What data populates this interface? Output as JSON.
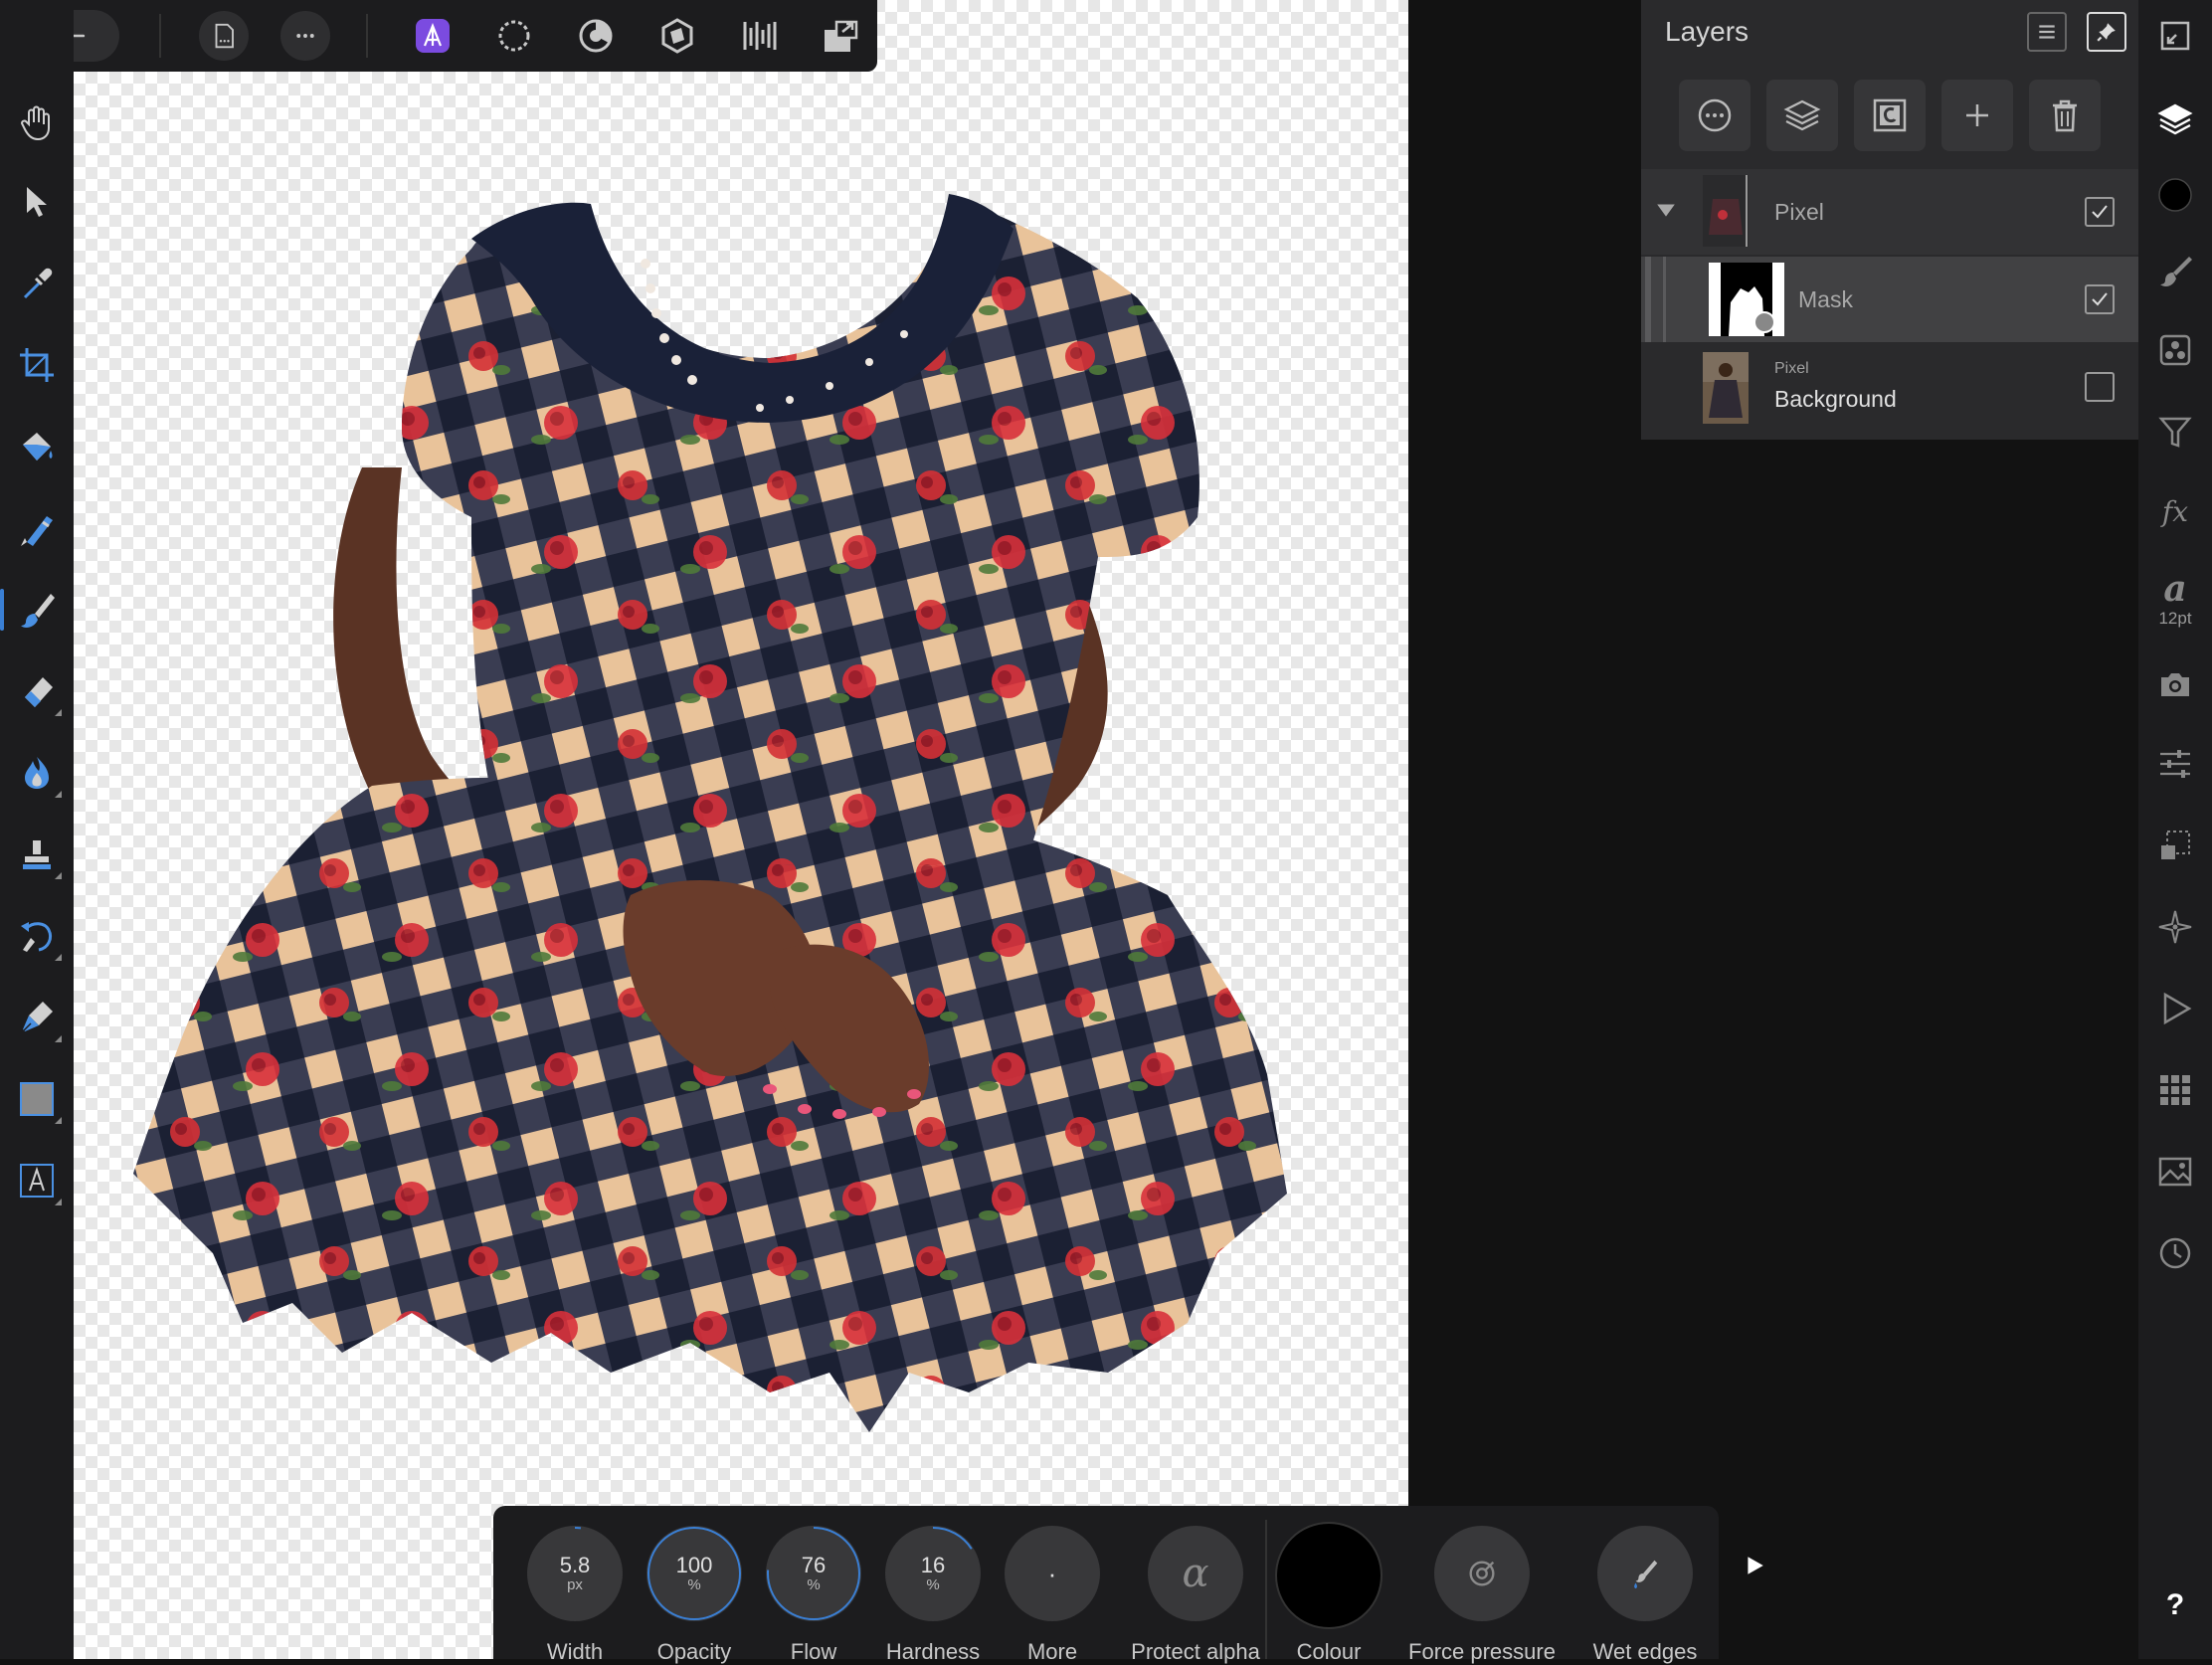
{
  "app": {
    "accent": "#7b4be0",
    "selection_blue": "#3a7fd4"
  },
  "top_toolbar": {
    "icons": [
      "back-arrow-icon",
      "document-icon",
      "more-icon",
      "photo-persona-icon",
      "liquify-persona-icon",
      "develop-persona-icon",
      "tone-mapping-persona-icon",
      "export-persona-icon",
      "arrange-icon"
    ]
  },
  "layers_panel": {
    "title": "Layers",
    "layers": [
      {
        "type": "",
        "name": "Pixel",
        "checked": true,
        "expanded": true
      },
      {
        "type": "",
        "name": "Mask",
        "checked": true,
        "selected": true
      },
      {
        "type": "Pixel",
        "name": "Background",
        "checked": false
      }
    ]
  },
  "right_toolbar": {
    "font_size": "12pt"
  },
  "context_bar": {
    "width": {
      "value": "5.8",
      "unit": "px",
      "label": "Width"
    },
    "opacity": {
      "value": "100",
      "unit": "%",
      "label": "Opacity"
    },
    "flow": {
      "value": "76",
      "unit": "%",
      "label": "Flow"
    },
    "hardness": {
      "value": "16",
      "unit": "%",
      "label": "Hardness"
    },
    "more": {
      "value": "·",
      "label": "More"
    },
    "protect_alpha": {
      "label": "Protect alpha"
    },
    "colour": {
      "label": "Colour",
      "color": "#000000"
    },
    "force_pressure": {
      "label": "Force pressure"
    },
    "wet_edges": {
      "label": "Wet edges"
    }
  }
}
